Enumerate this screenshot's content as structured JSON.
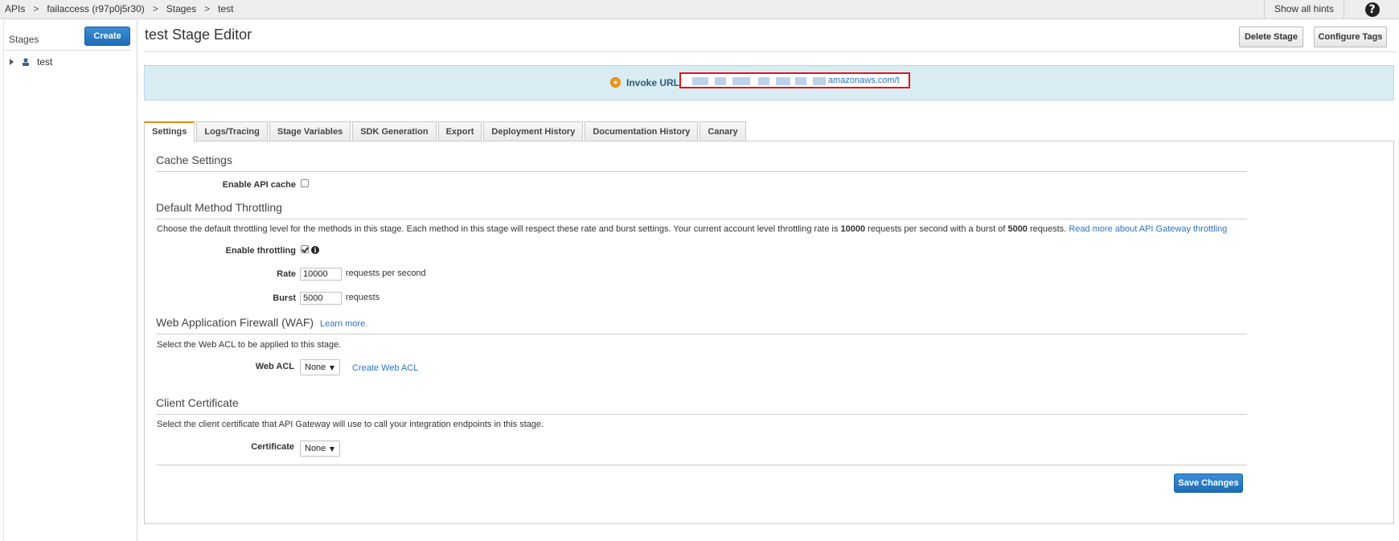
{
  "breadcrumb": {
    "items": [
      "APIs",
      "failaccess (r97p0j5r30)",
      "Stages",
      "test"
    ],
    "separator": ">"
  },
  "topbar": {
    "show_hints_label": "Show all hints",
    "help_icon": "question-circle-icon",
    "help_glyph": "?"
  },
  "sidebar": {
    "title": "Stages",
    "create_label": "Create",
    "tree": [
      {
        "label": "test",
        "icon": "stage-icon"
      }
    ]
  },
  "header": {
    "title": "test Stage Editor",
    "delete_label": "Delete Stage",
    "tags_label": "Configure Tags"
  },
  "invoke": {
    "label": "Invoke URL:",
    "url_visible": "amazonaws.com/t"
  },
  "tabs": [
    {
      "label": "Settings",
      "active": true
    },
    {
      "label": "Logs/Tracing",
      "active": false
    },
    {
      "label": "Stage Variables",
      "active": false
    },
    {
      "label": "SDK Generation",
      "active": false
    },
    {
      "label": "Export",
      "active": false
    },
    {
      "label": "Deployment History",
      "active": false
    },
    {
      "label": "Documentation History",
      "active": false
    },
    {
      "label": "Canary",
      "active": false
    }
  ],
  "cache": {
    "title": "Cache Settings",
    "enable_label": "Enable API cache",
    "enabled": false
  },
  "throttling": {
    "title": "Default Method Throttling",
    "desc_1": "Choose the default throttling level for the methods in this stage. Each method in this stage will respect these rate and burst settings. Your current account level throttling rate is ",
    "rate_limit": "10000",
    "desc_2": " requests per second with a burst of ",
    "burst_limit": "5000",
    "desc_3": " requests.",
    "read_more": "Read more about API Gateway throttling",
    "enable_label": "Enable throttling",
    "enabled": true,
    "rate_label": "Rate",
    "rate_value": "10000",
    "rate_unit": "requests per second",
    "burst_label": "Burst",
    "burst_value": "5000",
    "burst_unit": "requests"
  },
  "waf": {
    "title": "Web Application Firewall (WAF)",
    "learn_more": "Learn more.",
    "desc": "Select the Web ACL to be applied to this stage.",
    "acl_label": "Web ACL",
    "acl_value": "None",
    "create_link": "Create Web ACL"
  },
  "certificate": {
    "title": "Client Certificate",
    "desc": "Select the client certificate that API Gateway will use to call your integration endpoints in this stage.",
    "label": "Certificate",
    "value": "None"
  },
  "footer": {
    "save_label": "Save Changes"
  },
  "colors": {
    "primary_button": "#2d7ec9",
    "active_tab_accent": "#e38d12",
    "invoke_box_bg": "#d9ecf3",
    "link": "#2a73c5",
    "redaction_box": "#e0161b"
  }
}
